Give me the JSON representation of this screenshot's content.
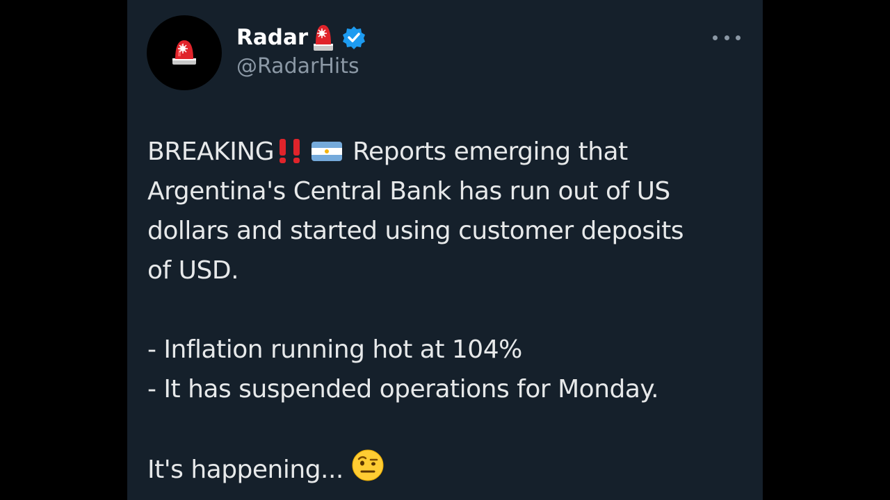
{
  "author": {
    "display_name": "Radar",
    "handle": "@RadarHits",
    "avatar_icon": "siren-icon",
    "verified_icon": "verified-badge-icon"
  },
  "tweet": {
    "breaking": "BREAKING",
    "line1_rest": " Reports emerging that",
    "line2": "Argentina's Central Bank has run out of US",
    "line3": "dollars and started using customer deposits",
    "line4": "of USD.",
    "bullet1": "- Inflation running hot at 104%",
    "bullet2": "- It has suspended operations for Monday.",
    "closing": "It's happening... "
  },
  "icons": {
    "double_exclamation": "double-exclamation-icon",
    "flag": "argentina-flag-icon",
    "closing_emoji": "raised-eyebrow-face-icon",
    "menu": "more-options-icon"
  },
  "colors": {
    "card_bg": "#15202b",
    "text": "#e7e9ea",
    "secondary": "#8b98a5",
    "verified": "#1d9bf0",
    "siren": "#e0242b"
  }
}
